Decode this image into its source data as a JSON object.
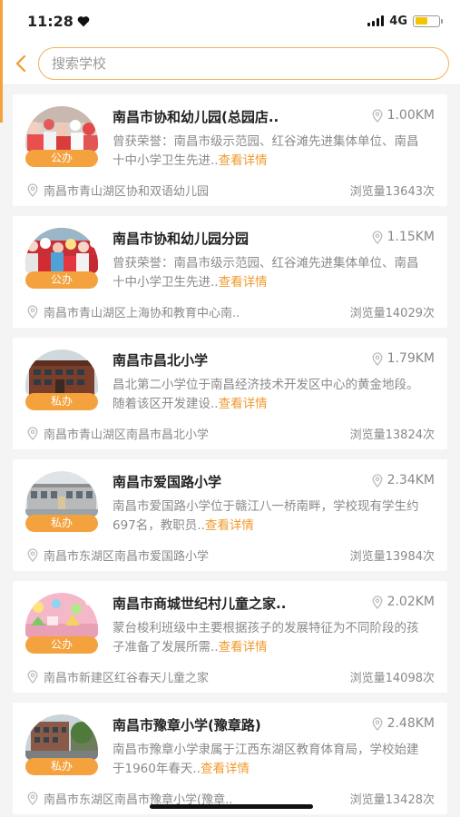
{
  "status_bar": {
    "time": "11:28",
    "network": "4G"
  },
  "search": {
    "placeholder": "搜索学校"
  },
  "schools": [
    {
      "name": "南昌市协和幼儿园(总园店..",
      "distance": "1.00KM",
      "type": "公办",
      "desc": "曾获荣誉：南昌市级示范园、红谷滩先进集体单位、南昌十中小学卫生先进..",
      "more": "查看详情",
      "address": "南昌市青山湖区协和双语幼儿园",
      "views": "浏览量13643次",
      "thumb": "crowd"
    },
    {
      "name": "南昌市协和幼儿园分园",
      "distance": "1.15KM",
      "type": "公办",
      "desc": "曾获荣誉：南昌市级示范园、红谷滩先进集体单位、南昌十中小学卫生先进..",
      "more": "查看详情",
      "address": "南昌市青山湖区上海协和教育中心南..",
      "views": "浏览量14029次",
      "thumb": "crowd-red"
    },
    {
      "name": "南昌市昌北小学",
      "distance": "1.79KM",
      "type": "私办",
      "desc": "昌北第二小学位于南昌经济技术开发区中心的黄金地段。随着该区开发建设..",
      "more": "查看详情",
      "address": "南昌市青山湖区南昌市昌北小学",
      "views": "浏览量13824次",
      "thumb": "building-brown"
    },
    {
      "name": "南昌市爱国路小学",
      "distance": "2.34KM",
      "type": "私办",
      "desc": "南昌市爱国路小学位于赣江八一桥南畔，学校现有学生约697名，教职员..",
      "more": "查看详情",
      "address": "南昌市东湖区南昌市爱国路小学",
      "views": "浏览量13984次",
      "thumb": "building-grey"
    },
    {
      "name": "南昌市商城世纪村儿童之家..",
      "distance": "2.02KM",
      "type": "公办",
      "desc": "蒙台梭利班级中主要根据孩子的发展特征为不同阶段的孩子准备了发展所需..",
      "more": "查看详情",
      "address": "南昌市新建区红谷春天儿童之家",
      "views": "浏览量14098次",
      "thumb": "pink-wall"
    },
    {
      "name": "南昌市豫章小学(豫章路)",
      "distance": "2.48KM",
      "type": "私办",
      "desc": "南昌市豫章小学隶属于江西东湖区教育体育局，学校始建于1960年春天..",
      "more": "查看详情",
      "address": "南昌市东湖区南昌市豫章小学(豫章..",
      "views": "浏览量13428次",
      "thumb": "building-street"
    }
  ]
}
